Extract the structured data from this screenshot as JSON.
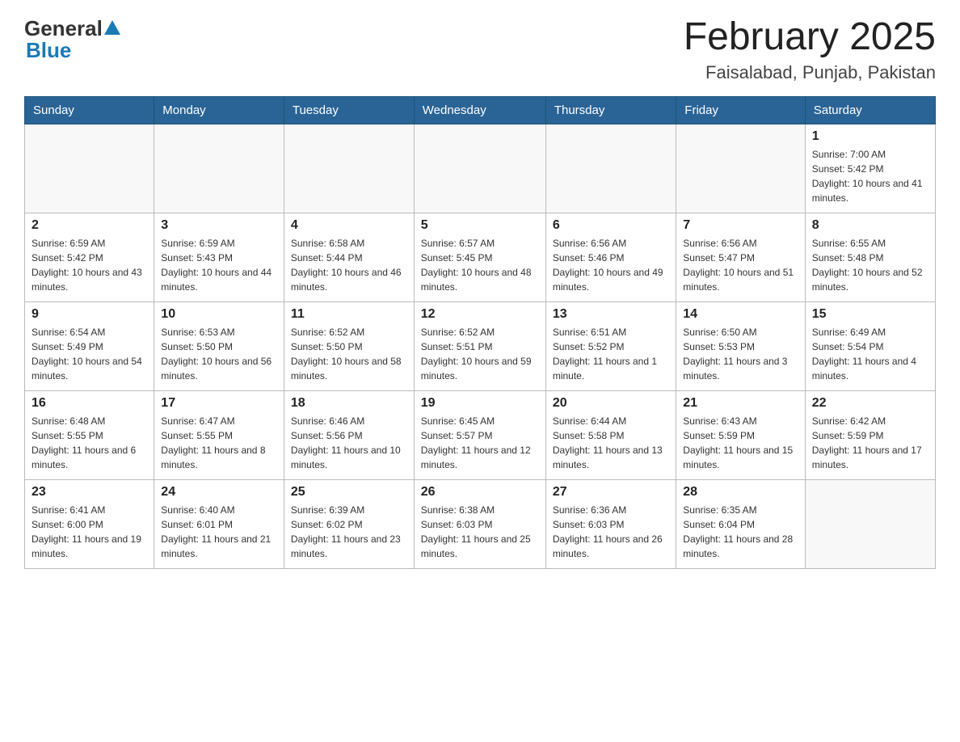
{
  "header": {
    "logo_general": "General",
    "logo_blue": "Blue",
    "month_year": "February 2025",
    "location": "Faisalabad, Punjab, Pakistan"
  },
  "days_of_week": [
    "Sunday",
    "Monday",
    "Tuesday",
    "Wednesday",
    "Thursday",
    "Friday",
    "Saturday"
  ],
  "weeks": [
    [
      {
        "day": "",
        "info": ""
      },
      {
        "day": "",
        "info": ""
      },
      {
        "day": "",
        "info": ""
      },
      {
        "day": "",
        "info": ""
      },
      {
        "day": "",
        "info": ""
      },
      {
        "day": "",
        "info": ""
      },
      {
        "day": "1",
        "info": "Sunrise: 7:00 AM\nSunset: 5:42 PM\nDaylight: 10 hours and 41 minutes."
      }
    ],
    [
      {
        "day": "2",
        "info": "Sunrise: 6:59 AM\nSunset: 5:42 PM\nDaylight: 10 hours and 43 minutes."
      },
      {
        "day": "3",
        "info": "Sunrise: 6:59 AM\nSunset: 5:43 PM\nDaylight: 10 hours and 44 minutes."
      },
      {
        "day": "4",
        "info": "Sunrise: 6:58 AM\nSunset: 5:44 PM\nDaylight: 10 hours and 46 minutes."
      },
      {
        "day": "5",
        "info": "Sunrise: 6:57 AM\nSunset: 5:45 PM\nDaylight: 10 hours and 48 minutes."
      },
      {
        "day": "6",
        "info": "Sunrise: 6:56 AM\nSunset: 5:46 PM\nDaylight: 10 hours and 49 minutes."
      },
      {
        "day": "7",
        "info": "Sunrise: 6:56 AM\nSunset: 5:47 PM\nDaylight: 10 hours and 51 minutes."
      },
      {
        "day": "8",
        "info": "Sunrise: 6:55 AM\nSunset: 5:48 PM\nDaylight: 10 hours and 52 minutes."
      }
    ],
    [
      {
        "day": "9",
        "info": "Sunrise: 6:54 AM\nSunset: 5:49 PM\nDaylight: 10 hours and 54 minutes."
      },
      {
        "day": "10",
        "info": "Sunrise: 6:53 AM\nSunset: 5:50 PM\nDaylight: 10 hours and 56 minutes."
      },
      {
        "day": "11",
        "info": "Sunrise: 6:52 AM\nSunset: 5:50 PM\nDaylight: 10 hours and 58 minutes."
      },
      {
        "day": "12",
        "info": "Sunrise: 6:52 AM\nSunset: 5:51 PM\nDaylight: 10 hours and 59 minutes."
      },
      {
        "day": "13",
        "info": "Sunrise: 6:51 AM\nSunset: 5:52 PM\nDaylight: 11 hours and 1 minute."
      },
      {
        "day": "14",
        "info": "Sunrise: 6:50 AM\nSunset: 5:53 PM\nDaylight: 11 hours and 3 minutes."
      },
      {
        "day": "15",
        "info": "Sunrise: 6:49 AM\nSunset: 5:54 PM\nDaylight: 11 hours and 4 minutes."
      }
    ],
    [
      {
        "day": "16",
        "info": "Sunrise: 6:48 AM\nSunset: 5:55 PM\nDaylight: 11 hours and 6 minutes."
      },
      {
        "day": "17",
        "info": "Sunrise: 6:47 AM\nSunset: 5:55 PM\nDaylight: 11 hours and 8 minutes."
      },
      {
        "day": "18",
        "info": "Sunrise: 6:46 AM\nSunset: 5:56 PM\nDaylight: 11 hours and 10 minutes."
      },
      {
        "day": "19",
        "info": "Sunrise: 6:45 AM\nSunset: 5:57 PM\nDaylight: 11 hours and 12 minutes."
      },
      {
        "day": "20",
        "info": "Sunrise: 6:44 AM\nSunset: 5:58 PM\nDaylight: 11 hours and 13 minutes."
      },
      {
        "day": "21",
        "info": "Sunrise: 6:43 AM\nSunset: 5:59 PM\nDaylight: 11 hours and 15 minutes."
      },
      {
        "day": "22",
        "info": "Sunrise: 6:42 AM\nSunset: 5:59 PM\nDaylight: 11 hours and 17 minutes."
      }
    ],
    [
      {
        "day": "23",
        "info": "Sunrise: 6:41 AM\nSunset: 6:00 PM\nDaylight: 11 hours and 19 minutes."
      },
      {
        "day": "24",
        "info": "Sunrise: 6:40 AM\nSunset: 6:01 PM\nDaylight: 11 hours and 21 minutes."
      },
      {
        "day": "25",
        "info": "Sunrise: 6:39 AM\nSunset: 6:02 PM\nDaylight: 11 hours and 23 minutes."
      },
      {
        "day": "26",
        "info": "Sunrise: 6:38 AM\nSunset: 6:03 PM\nDaylight: 11 hours and 25 minutes."
      },
      {
        "day": "27",
        "info": "Sunrise: 6:36 AM\nSunset: 6:03 PM\nDaylight: 11 hours and 26 minutes."
      },
      {
        "day": "28",
        "info": "Sunrise: 6:35 AM\nSunset: 6:04 PM\nDaylight: 11 hours and 28 minutes."
      },
      {
        "day": "",
        "info": ""
      }
    ]
  ]
}
